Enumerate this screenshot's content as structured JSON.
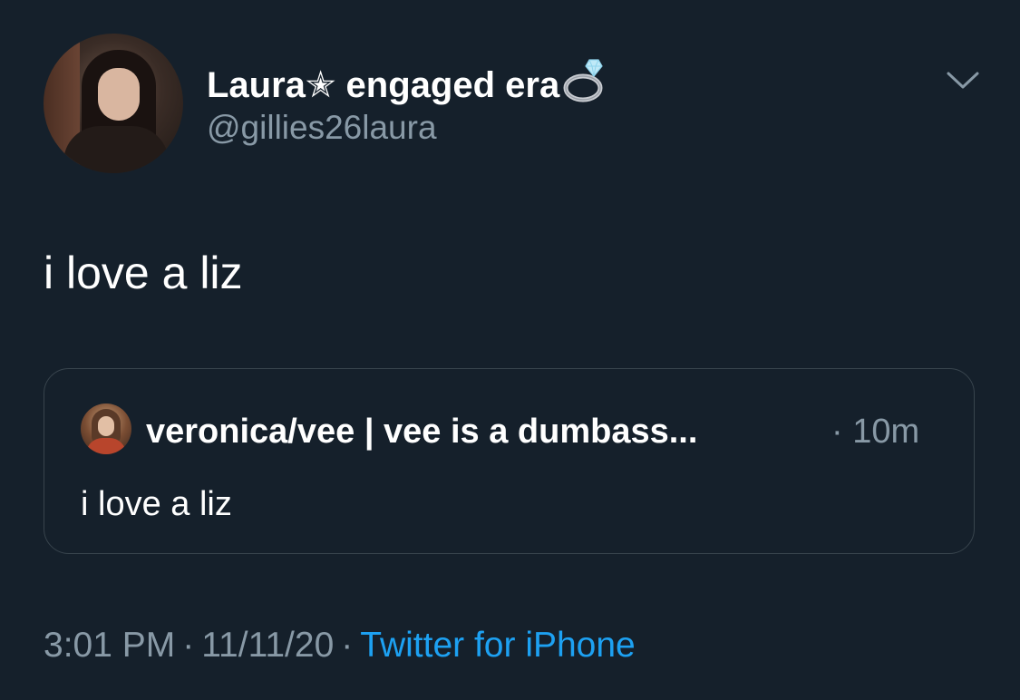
{
  "author": {
    "display_name": "Laura✭ engaged era",
    "ring_icon": "ring-icon",
    "handle": "@gillies26laura",
    "avatar": "avatar-photo"
  },
  "menu_icon": "chevron-down-icon",
  "tweet": {
    "text": "i love a liz"
  },
  "quoted_tweet": {
    "display_name": "veronica/vee | vee is a dumbass...",
    "time": "· 10m",
    "text": "i love a liz"
  },
  "meta": {
    "time": "3:01 PM",
    "separator": "·",
    "date": "11/11/20",
    "source": "Twitter for iPhone"
  },
  "colors": {
    "background": "#15202b",
    "secondary_text": "#8899a6",
    "link": "#1da1f2",
    "border": "#38444d"
  }
}
